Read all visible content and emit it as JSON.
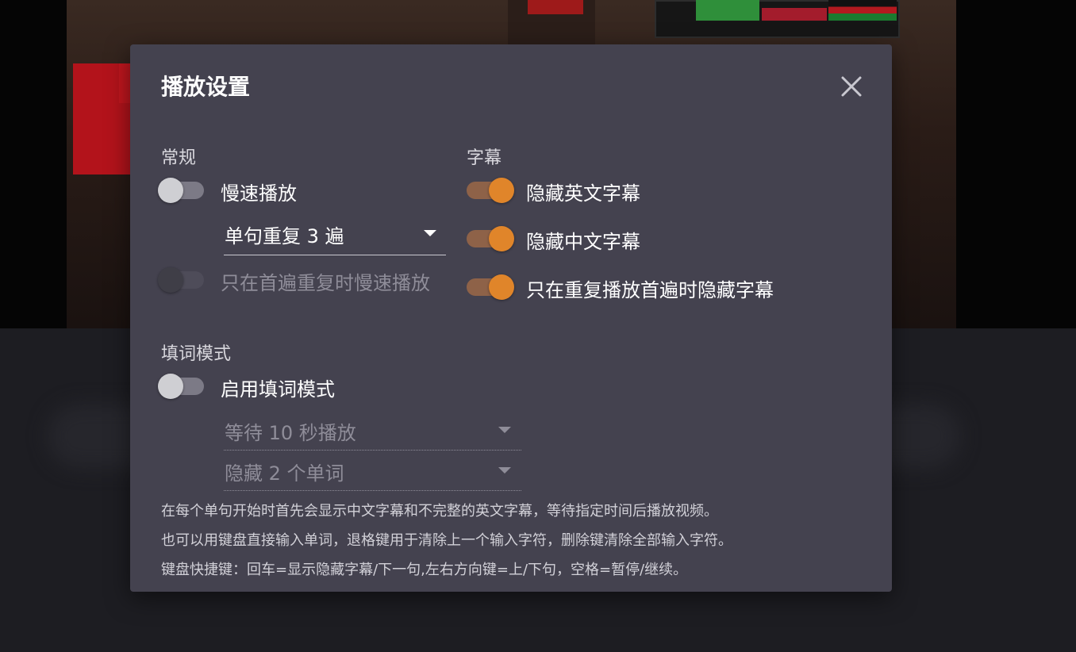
{
  "dialog": {
    "title": "播放设置"
  },
  "general": {
    "section_title": "常规",
    "slow_play": {
      "label": "慢速播放",
      "enabled": false
    },
    "repeat_select": {
      "value": "单句重复 3 遍"
    },
    "slow_first_only": {
      "label": "只在首遍重复时慢速播放",
      "enabled": false,
      "disabled": true
    }
  },
  "subtitles": {
    "section_title": "字幕",
    "hide_english": {
      "label": "隐藏英文字幕",
      "enabled": true
    },
    "hide_chinese": {
      "label": "隐藏中文字幕",
      "enabled": true
    },
    "hide_first_only": {
      "label": "只在重复播放首遍时隐藏字幕",
      "enabled": true
    }
  },
  "cloze": {
    "section_title": "填词模式",
    "enable": {
      "label": "启用填词模式",
      "enabled": false
    },
    "wait_select": {
      "value": "等待 10 秒播放"
    },
    "hide_words_select": {
      "value": "隐藏 2 个单词"
    },
    "help_lines": [
      "在每个单句开始时首先会显示中文字幕和不完整的英文字幕，等待指定时间后播放视频。",
      "也可以用键盘直接输入单词，退格键用于清除上一个输入字符，删除键清除全部输入字符。",
      "键盘快捷键：回车=显示隐藏字幕/下一句,左右方向键=上/下句，空格=暂停/继续。"
    ]
  },
  "colors": {
    "accent": "#e0852a",
    "dialog_bg": "#44424f"
  },
  "icons": {
    "close": "close-icon",
    "dropdown": "chevron-down-icon"
  }
}
